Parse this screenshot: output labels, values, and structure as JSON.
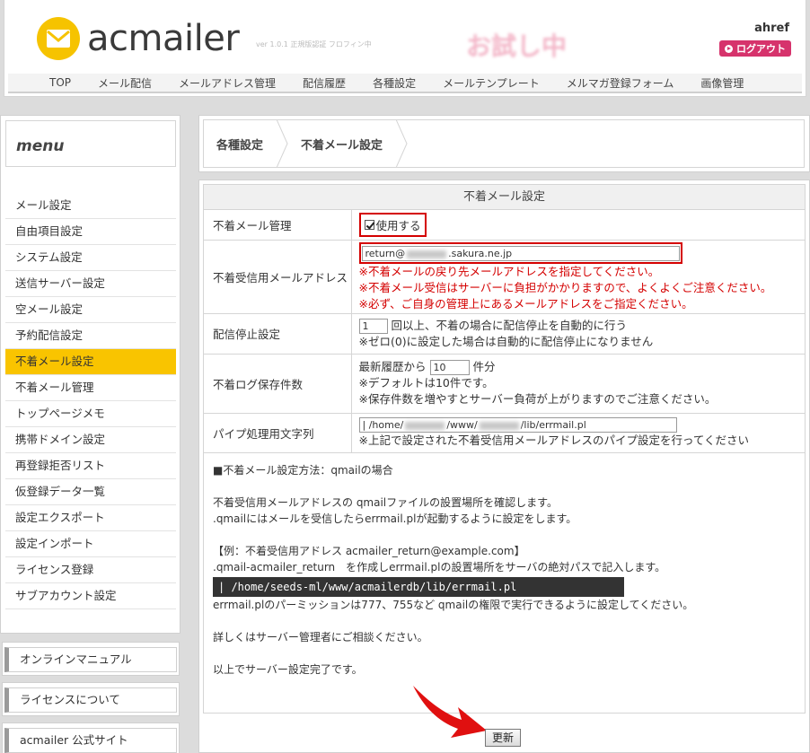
{
  "header": {
    "logo_text": "acmailer",
    "version_text": "ver 1.0.1 正規版認証 フロフィン中",
    "trial_label": "お試し中",
    "user_name": "ahref",
    "logout_label": "ログアウト"
  },
  "topnav": [
    "TOP",
    "メール配信",
    "メールアドレス管理",
    "配信履歴",
    "各種設定",
    "メールテンプレート",
    "メルマガ登録フォーム",
    "画像管理"
  ],
  "sidebar": {
    "title": "menu",
    "items": [
      {
        "label": "メール設定",
        "active": false
      },
      {
        "label": "自由項目設定",
        "active": false
      },
      {
        "label": "システム設定",
        "active": false
      },
      {
        "label": "送信サーバー設定",
        "active": false
      },
      {
        "label": "空メール設定",
        "active": false
      },
      {
        "label": "予約配信設定",
        "active": false
      },
      {
        "label": "不着メール設定",
        "active": true
      },
      {
        "label": "不着メール管理",
        "active": false
      },
      {
        "label": "トップページメモ",
        "active": false
      },
      {
        "label": "携帯ドメイン設定",
        "active": false
      },
      {
        "label": "再登録拒否リスト",
        "active": false
      },
      {
        "label": "仮登録データ一覧",
        "active": false
      },
      {
        "label": "設定エクスポート",
        "active": false
      },
      {
        "label": "設定インポート",
        "active": false
      },
      {
        "label": "ライセンス登録",
        "active": false
      },
      {
        "label": "サブアカウント設定",
        "active": false
      }
    ],
    "links": [
      "オンラインマニュアル",
      "ライセンスについて",
      "acmailer 公式サイト"
    ]
  },
  "breadcrumb": [
    "各種設定",
    "不着メール設定"
  ],
  "settings": {
    "title": "不着メール設定",
    "rows": {
      "manage": {
        "label": "不着メール管理",
        "checkbox_label": "使用する",
        "checked": true
      },
      "address": {
        "label": "不着受信用メールアドレス",
        "value_prefix": "return@",
        "value_suffix": ".sakura.ne.jp",
        "notes": [
          "※不着メールの戻り先メールアドレスを指定してください。",
          "※不着メール受信はサーバーに負担がかかりますので、よくよくご注意ください。",
          "※必ず、ご自身の管理上にあるメールアドレスをご指定ください。"
        ]
      },
      "stop": {
        "label": "配信停止設定",
        "value": "1",
        "text": "回以上、不着の場合に配信停止を自動的に行う",
        "note": "※ゼロ(0)に設定した場合は自動的に配信停止になりません"
      },
      "log": {
        "label": "不着ログ保存件数",
        "prefix": "最新履歴から",
        "value": "10",
        "suffix": "件分",
        "notes": [
          "※デフォルトは10件です。",
          "※保存件数を増やすとサーバー負荷が上がりますのでご注意ください。"
        ]
      },
      "pipe": {
        "label": "パイプ処理用文字列",
        "value_p1": "| /home/",
        "value_p2": "/www/",
        "value_p3": "/lib/errmail.pl",
        "note": "※上記で設定された不着受信用メールアドレスのパイプ設定を行ってください"
      }
    },
    "howto": {
      "heading": "■不着メール設定方法：qmailの場合",
      "p1": "不着受信用メールアドレスの qmailファイルの設置場所を確認します。",
      "p2": ".qmailにはメールを受信したらerrmail.plが起動するように設定をします。",
      "p3": "【例：不着受信用アドレス acmailer_return@example.com】",
      "p4": ".qmail-acmailer_return　を作成しerrmail.plの設置場所をサーバの絶対パスで記入します。",
      "code": "| /home/seeds-ml/www/acmailerdb/lib/errmail.pl",
      "p5": "errmail.plのパーミッションは777、755など qmailの権限で実行できるように設定してください。",
      "p6": "詳しくはサーバー管理者にご相談ください。",
      "p7": "以上でサーバー設定完了です。"
    },
    "update_label": "更新"
  },
  "colors": {
    "accent": "#f9c400",
    "logout": "#d6336c",
    "highlight": "#d40000"
  }
}
